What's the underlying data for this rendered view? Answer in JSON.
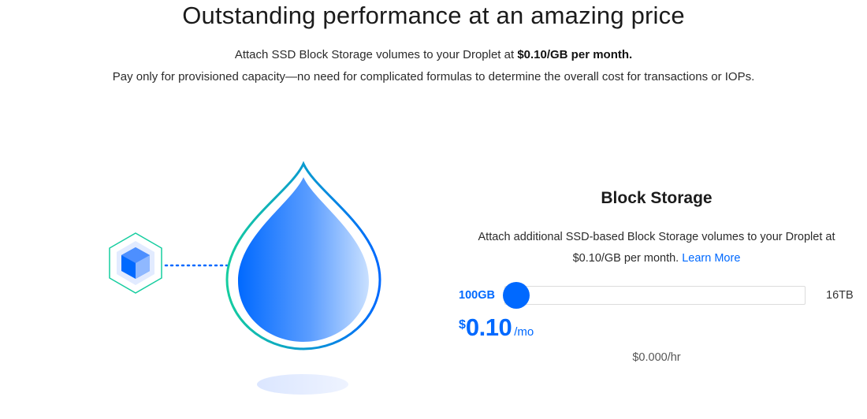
{
  "header": {
    "title": "Outstanding performance at an amazing price",
    "line1_prefix": "Attach SSD Block Storage volumes to your Droplet at ",
    "line1_bold": "$0.10/GB per month.",
    "line2": "Pay only for provisioned capacity—no need for complicated formulas to determine the overall cost for transactions or IOPs."
  },
  "illustration": {
    "icons": [
      "storage-cube-icon",
      "water-drop-icon"
    ],
    "colors": {
      "drop_blue": "#0069ff",
      "outline_teal": "#15cd9f"
    }
  },
  "block_storage": {
    "title": "Block Storage",
    "description_prefix": "Attach additional SSD-based Block Storage volumes to your Droplet at $0.10/GB per month. ",
    "learn_more": "Learn More",
    "slider": {
      "min_label": "100GB",
      "max_label": "16TB",
      "value_fraction": 0.0
    },
    "price": {
      "currency": "$",
      "amount": "0.10",
      "period": "/mo"
    },
    "hourly": "$0.000/hr"
  },
  "colors": {
    "accent": "#0069ff",
    "text": "#1f1f1f"
  }
}
